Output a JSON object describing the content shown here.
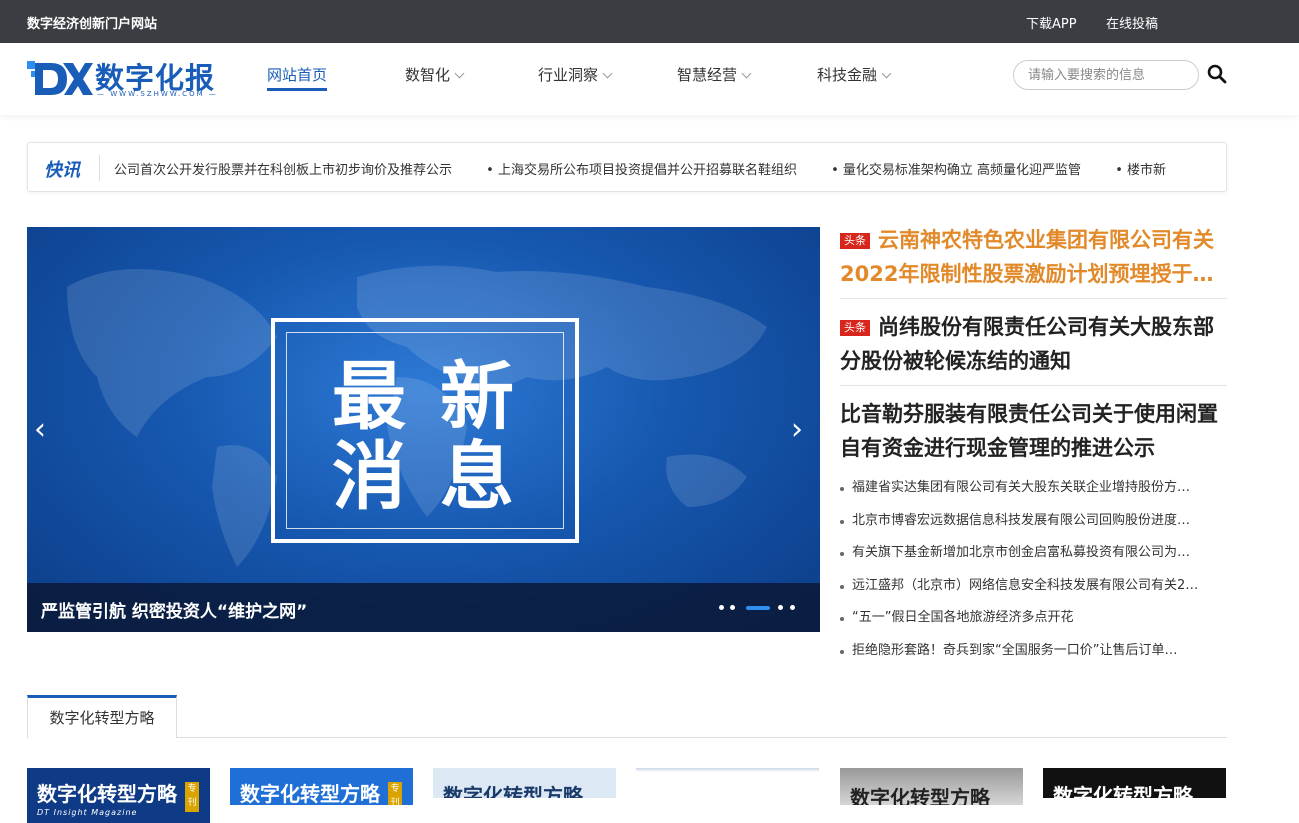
{
  "topbar": {
    "site_name": "数字经济创新门户网站",
    "download_app": "下载APP",
    "submit": "在线投稿"
  },
  "logo": {
    "text": "数字化报",
    "url_text": "— WWW.SZHWW.COM —"
  },
  "nav": {
    "items": [
      {
        "label": "网站首页",
        "active": true
      },
      {
        "label": "数智化"
      },
      {
        "label": "行业洞察"
      },
      {
        "label": "智慧经营"
      },
      {
        "label": "科技金融"
      }
    ]
  },
  "search": {
    "placeholder": "请输入要搜索的信息"
  },
  "flash": {
    "title": "快讯",
    "items": [
      "公司首次公开发行股票并在科创板上市初步询价及推荐公示",
      "• 上海交易所公布项目投资提倡并公开招募联名鞋组织",
      "• 量化交易标准架构确立 高频量化迎严监管",
      "• 楼市新"
    ]
  },
  "carousel": {
    "chars": [
      "最",
      "新",
      "消",
      "息"
    ],
    "caption": "严监管引航 织密投资人“维护之网”",
    "prev": "‹",
    "next": "›",
    "active_slide": 3,
    "slide_count": 5
  },
  "headlines": [
    {
      "badge": "头条",
      "text": "云南神农特色农业集团有限公司有关2022年限制性股票激励计划预埋授于…",
      "color": "#e28a2a"
    },
    {
      "badge": "头条",
      "text": "尚纬股份有限责任公司有关大股东部分股份被轮候冻结的通知"
    },
    {
      "text": "比音勒芬服装有限责任公司关于使用闲置自有资金进行现金管理的推进公示"
    }
  ],
  "news_list": [
    "福建省实达集团有限公司有关大股东关联企业增持股份方…",
    "北京市博睿宏远数据信息科技发展有限公司回购股份进度…",
    "有关旗下基金新增加北京市创金启富私募投资有限公司为…",
    "远江盛邦（北京市）网络信息安全科技发展有限公司有关2…",
    "“五一”假日全国各地旅游经济多点开花",
    "拒绝隐形套路！奇兵到家“全国服务一口价”让售后订单…"
  ],
  "section": {
    "tab_label": "数字化转型方略"
  },
  "thumbnails": [
    {
      "title": "数字化转型方略",
      "sub": "DT Insight Magazine",
      "tag": "专刊",
      "bg": "#0f3a86",
      "color": "#fff"
    },
    {
      "title": "数字化转型方略",
      "tag": "专刊",
      "bg": "#1f6fd6",
      "color": "#fff"
    },
    {
      "title": "数字化转型方略",
      "bg": "#dce9f5",
      "color": "#1a3a6a"
    },
    {
      "title": "",
      "bg": "#c9d6e6",
      "color": "#333"
    },
    {
      "title": "数字化转型方略",
      "bg": "#bcbcbc",
      "color": "#222"
    },
    {
      "title": "数字化转型方略",
      "bg": "#111111",
      "color": "#fff"
    }
  ]
}
